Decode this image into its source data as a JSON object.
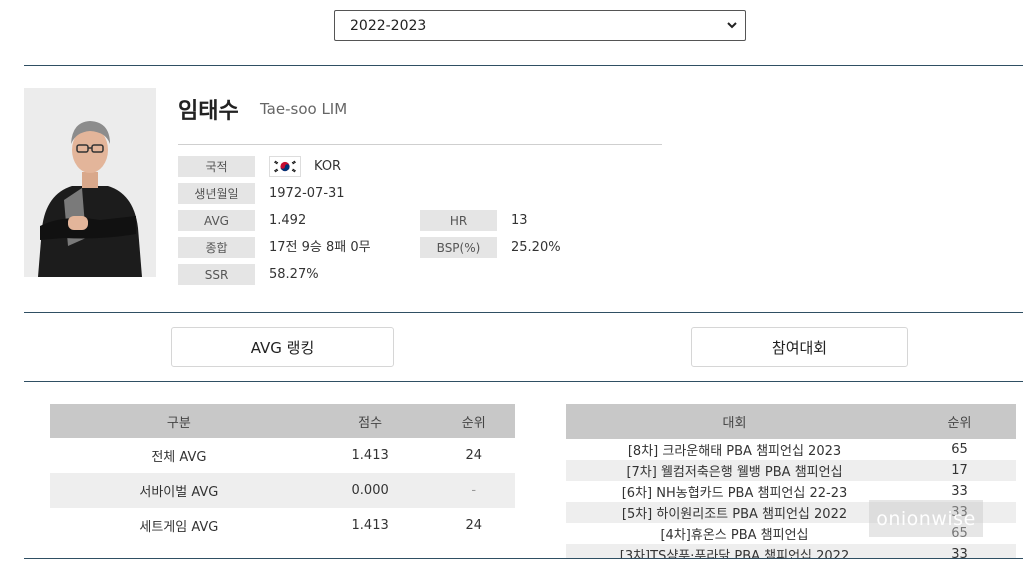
{
  "season_select": {
    "value": "2022-2023"
  },
  "player": {
    "name_ko": "임태수",
    "name_en": "Tae-soo LIM",
    "nationality_label": "국적",
    "nationality": "KOR",
    "birth_label": "생년월일",
    "birth": "1972-07-31",
    "avg_label": "AVG",
    "avg": "1.492",
    "hr_label": "HR",
    "hr": "13",
    "record_label": "종합",
    "record": "17전 9승 8패 0무",
    "bsp_label": "BSP(%)",
    "bsp": "25.20%",
    "ssr_label": "SSR",
    "ssr": "58.27%"
  },
  "tabs": {
    "avg_ranking": "AVG 랭킹",
    "tournaments": "참여대회"
  },
  "avg_table": {
    "headers": [
      "구분",
      "점수",
      "순위"
    ],
    "rows": [
      [
        "전체 AVG",
        "1.413",
        "24"
      ],
      [
        "서바이벌 AVG",
        "0.000",
        "-"
      ],
      [
        "세트게임 AVG",
        "1.413",
        "24"
      ]
    ]
  },
  "tournament_table": {
    "headers": [
      "대회",
      "순위"
    ],
    "rows": [
      [
        "[8차] 크라운해태 PBA 챔피언십 2023",
        "65"
      ],
      [
        "[7차] 웰컴저축은행 웰뱅 PBA 챔피언십",
        "17"
      ],
      [
        "[6차] NH농협카드 PBA 챔피언십 22-23",
        "33"
      ],
      [
        "[5차] 하이원리조트 PBA 챔피언십 2022",
        "33"
      ],
      [
        "[4차]휴온스 PBA 챔피언십",
        "65"
      ],
      [
        "[3차]TS샴푸·푸라닭 PBA 챔피언십 2022",
        "33"
      ]
    ]
  },
  "watermark": "onionwise",
  "colors": {
    "rule": "#2f4f63",
    "header_gray": "#c8c8c8",
    "label_gray": "#e5e5e5",
    "stripe": "#eeeeee"
  }
}
